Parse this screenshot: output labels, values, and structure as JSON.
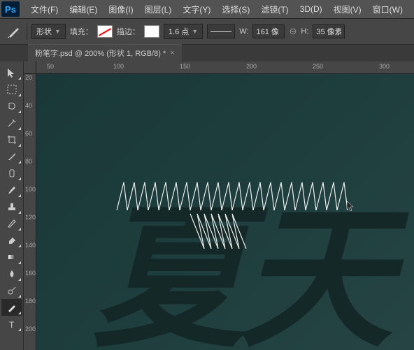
{
  "app": {
    "logo": "Ps"
  },
  "menu": {
    "file": "文件(F)",
    "edit": "编辑(E)",
    "image": "图像(I)",
    "layer": "图层(L)",
    "type": "文字(Y)",
    "select": "选择(S)",
    "filter": "滤镜(T)",
    "threed": "3D(D)",
    "view": "视图(V)",
    "window": "窗口(W)"
  },
  "options": {
    "mode": "形状",
    "fill_label": "填充：",
    "stroke_label": "描边：",
    "stroke_size": "1.6 点",
    "w_label": "W:",
    "w_value": "161 像",
    "h_label": "H:",
    "h_value": "35 像素"
  },
  "tab": {
    "title": "粉笔字.psd @ 200% (形状 1, RGB/8) *",
    "close": "×"
  },
  "ruler_h": [
    "50",
    "100",
    "150",
    "200",
    "250",
    "300"
  ],
  "ruler_v": [
    "0",
    "2",
    "0",
    "4",
    "0",
    "6",
    "0",
    "8",
    "0",
    "0",
    "1",
    "0",
    "2",
    "1",
    "0",
    "4",
    "1",
    "0",
    "6",
    "1",
    "0",
    "8",
    "2",
    "0",
    "0",
    "2",
    "0",
    "2"
  ],
  "ruler_v_labels": [
    {
      "v": "20",
      "t": 0
    },
    {
      "v": "40",
      "t": 40
    },
    {
      "v": "60",
      "t": 80
    },
    {
      "v": "80",
      "t": 120
    },
    {
      "v": "100",
      "t": 160
    },
    {
      "v": "120",
      "t": 200
    },
    {
      "v": "140",
      "t": 240
    },
    {
      "v": "160",
      "t": 280
    },
    {
      "v": "180",
      "t": 320
    },
    {
      "v": "200",
      "t": 360
    }
  ],
  "canvas": {
    "text": "夏天"
  }
}
